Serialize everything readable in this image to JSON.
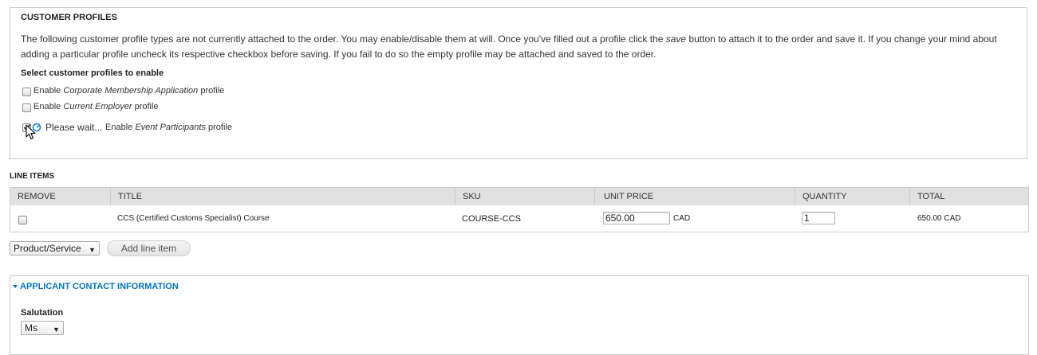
{
  "customer_profiles": {
    "title": "CUSTOMER PROFILES",
    "description_part1": "The following customer profile types are not currently attached to the order. You may enable/disable them at will. Once you've filled out a profile click the ",
    "description_em": "save",
    "description_part2": " button to attach it to the order and save it. If you change your mind about adding a particular profile uncheck its respective checkbox before saving. If you fail to do so the empty profile may be attached and saved to the order.",
    "select_label": "Select customer profiles to enable",
    "options": [
      {
        "prefix": "Enable ",
        "name": "Corporate Membership Application",
        "suffix": " profile",
        "checked": false
      },
      {
        "prefix": "Enable ",
        "name": "Current Employer",
        "suffix": " profile",
        "checked": false
      },
      {
        "prefix": "Enable ",
        "name": "Event Participants",
        "suffix": " profile",
        "checked": true
      }
    ],
    "wait_text": "Please wait..."
  },
  "line_items": {
    "title": "LINE ITEMS",
    "columns": [
      "REMOVE",
      "TITLE",
      "SKU",
      "UNIT PRICE",
      "QUANTITY",
      "TOTAL"
    ],
    "rows": [
      {
        "title": "CCS (Certified Customs Specialist) Course",
        "sku": "COURSE-CCS",
        "unit_price": "650.00",
        "currency": "CAD",
        "quantity": "1",
        "total": "650.00 CAD"
      }
    ],
    "type_select": "Product/Service",
    "add_button": "Add line item"
  },
  "applicant": {
    "legend": "APPLICANT CONTACT INFORMATION",
    "salutation_label": "Salutation",
    "salutation_value": "Ms"
  },
  "colors": {
    "link": "#0074bd",
    "header_bg": "#e1e1e1",
    "border": "#cccccc"
  }
}
